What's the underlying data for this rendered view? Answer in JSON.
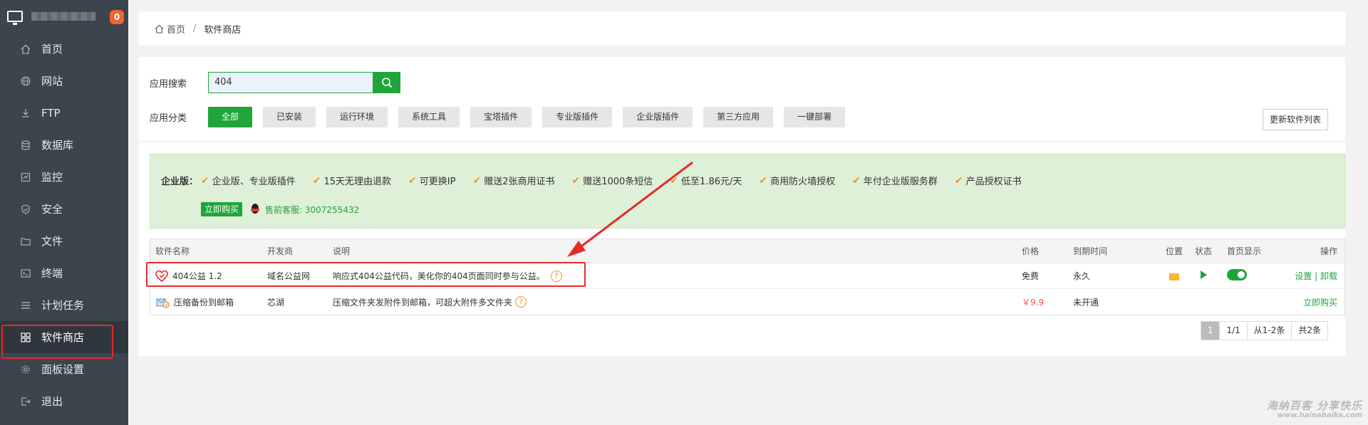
{
  "sidebar": {
    "badge": "0",
    "items": [
      {
        "label": "首页",
        "icon": "home-icon"
      },
      {
        "label": "网站",
        "icon": "globe-icon"
      },
      {
        "label": "FTP",
        "icon": "ftp-icon"
      },
      {
        "label": "数据库",
        "icon": "database-icon"
      },
      {
        "label": "监控",
        "icon": "monitor-chart-icon"
      },
      {
        "label": "安全",
        "icon": "shield-icon"
      },
      {
        "label": "文件",
        "icon": "folder-icon"
      },
      {
        "label": "终端",
        "icon": "terminal-icon"
      },
      {
        "label": "计划任务",
        "icon": "clock-icon"
      },
      {
        "label": "软件商店",
        "icon": "grid-icon",
        "active": true
      },
      {
        "label": "面板设置",
        "icon": "gear-icon"
      },
      {
        "label": "退出",
        "icon": "logout-icon"
      }
    ]
  },
  "breadcrumb": {
    "home": "首页",
    "separator": "/",
    "current": "软件商店"
  },
  "search": {
    "label": "应用搜索",
    "value": "404"
  },
  "categories": {
    "label": "应用分类",
    "items": [
      "全部",
      "已安装",
      "运行环境",
      "系统工具",
      "宝塔插件",
      "专业版插件",
      "企业版插件",
      "第三方应用",
      "一键部署"
    ],
    "active": "全部"
  },
  "update_button": "更新软件列表",
  "promo": {
    "head": "企业版：",
    "features": [
      "企业版、专业版插件",
      "15天无理由退款",
      "可更换IP",
      "赠送2张商用证书",
      "赠送1000条短信",
      "低至1.86元/天",
      "商用防火墙授权",
      "年付企业版服务群",
      "产品授权证书"
    ],
    "buy": "立即购买",
    "service": "售前客服: 3007255432"
  },
  "table": {
    "headers": [
      "软件名称",
      "开发商",
      "说明",
      "价格",
      "到期时间",
      "位置",
      "状态",
      "首页显示",
      "操作"
    ],
    "rows": [
      {
        "name": "404公益 1.2",
        "vendor": "域名公益网",
        "desc": "响应式404公益代码，美化你的404页面同时参与公益。",
        "price": "免费",
        "expire": "永久",
        "action_set": "设置",
        "action_sep": "|",
        "action_uninstall": "卸载"
      },
      {
        "name": "压缩备份到邮箱",
        "vendor": "芯湖",
        "desc": "压缩文件夹发附件到邮箱，可超大附件多文件夹",
        "price": "￥9.9",
        "expire": "未开通",
        "action_buy": "立即购买"
      }
    ]
  },
  "pagination": {
    "current": "1",
    "pages": "1/1",
    "range": "从1-2条",
    "total": "共2条"
  },
  "watermark": {
    "line1": "海纳百客 分享快乐",
    "line2": "www.hainabaike.com"
  },
  "colors": {
    "accent": "#20a53a",
    "sidebar": "#3c444d",
    "highlight": "#e52a2a",
    "badge": "#f0652f"
  }
}
